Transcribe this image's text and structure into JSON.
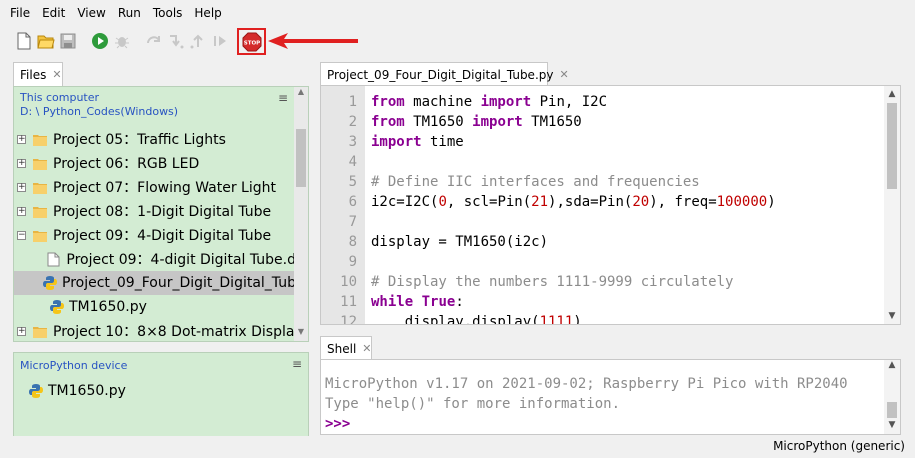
{
  "menu": [
    "File",
    "Edit",
    "View",
    "Run",
    "Tools",
    "Help"
  ],
  "toolbar": {
    "stop_label": "STOP"
  },
  "files": {
    "tab_label": "Files",
    "this_computer": "This computer",
    "path": "D: \\ Python_Codes(Windows)",
    "items": [
      {
        "label": "Project 05：Traffic Lights",
        "type": "folder",
        "expander": "+"
      },
      {
        "label": "Project 06：RGB LED",
        "type": "folder",
        "expander": "+"
      },
      {
        "label": "Project 07：Flowing Water Light",
        "type": "folder",
        "expander": "+"
      },
      {
        "label": "Project 08：1-Digit Digital Tube",
        "type": "folder",
        "expander": "+"
      },
      {
        "label": "Project 09：4-Digit Digital Tube",
        "type": "folder",
        "expander": "−"
      },
      {
        "label": "Project 09：4-digit Digital Tube.d",
        "type": "doc"
      },
      {
        "label": "Project_09_Four_Digit_Digital_Tub",
        "type": "py",
        "selected": true
      },
      {
        "label": "TM1650.py",
        "type": "py"
      },
      {
        "label": "Project 10：8×8 Dot-matrix Display",
        "type": "folder",
        "expander": "+"
      }
    ]
  },
  "device": {
    "title": "MicroPython device",
    "items": [
      "TM1650.py"
    ]
  },
  "editor": {
    "tab_label": "Project_09_Four_Digit_Digital_Tube.py",
    "lines": [
      {
        "n": "1",
        "html": "<span class=\"kw\">from</span> machine <span class=\"kw\">import</span> Pin, I2C"
      },
      {
        "n": "2",
        "html": "<span class=\"kw\">from</span> TM1650 <span class=\"kw\">import</span> TM1650"
      },
      {
        "n": "3",
        "html": "<span class=\"kw\">import</span> time"
      },
      {
        "n": "4",
        "html": ""
      },
      {
        "n": "5",
        "html": "<span class=\"cm\"># Define IIC interfaces and frequencies</span>"
      },
      {
        "n": "6",
        "html": "i2c=I2C(<span class=\"nm\">0</span>, scl=Pin(<span class=\"nm\">21</span>),sda=Pin(<span class=\"nm\">20</span>), freq=<span class=\"nm\">100000</span>)"
      },
      {
        "n": "7",
        "html": ""
      },
      {
        "n": "8",
        "html": "display = TM1650(i2c)"
      },
      {
        "n": "9",
        "html": ""
      },
      {
        "n": "10",
        "html": "<span class=\"cm\"># Display the numbers 1111-9999 circulately</span>"
      },
      {
        "n": "11",
        "html": "<span class=\"kw\">while</span> <span class=\"kw\">True</span>:"
      },
      {
        "n": "12",
        "html": "    display.display(<span class=\"nm\">1111</span>)"
      }
    ]
  },
  "shell": {
    "tab_label": "Shell",
    "line1": "MicroPython v1.17 on 2021-09-02; Raspberry Pi Pico with RP2040",
    "line2": "Type \"help()\" for more information.",
    "prompt": ">>>"
  },
  "status": {
    "interpreter": "MicroPython (generic)"
  },
  "colors": {
    "panel_bg": "#d3ecd3",
    "keyword": "#8a0091",
    "comment": "#8c8c8c",
    "number": "#c00000",
    "highlight": "#e02020"
  }
}
